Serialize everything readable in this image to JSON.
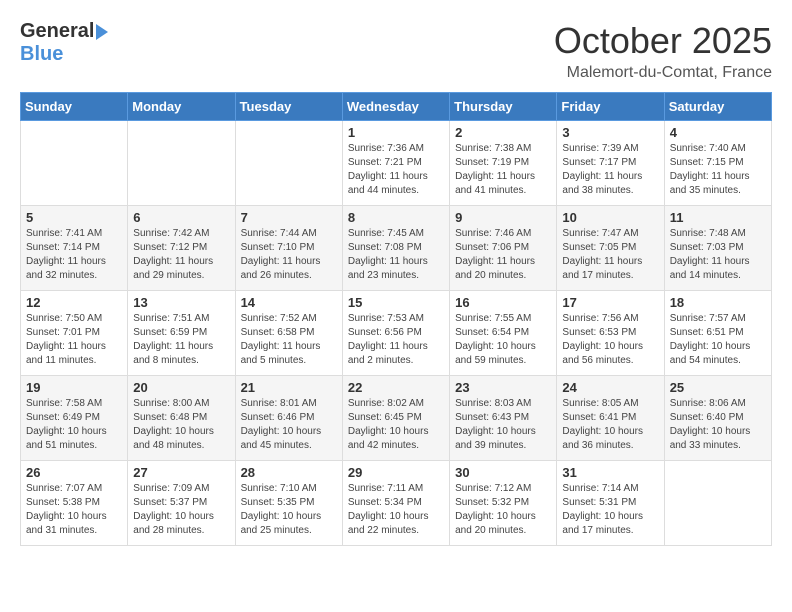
{
  "header": {
    "logo_general": "General",
    "logo_blue": "Blue",
    "month": "October 2025",
    "location": "Malemort-du-Comtat, France"
  },
  "calendar": {
    "days_of_week": [
      "Sunday",
      "Monday",
      "Tuesday",
      "Wednesday",
      "Thursday",
      "Friday",
      "Saturday"
    ],
    "weeks": [
      [
        {
          "day": "",
          "info": ""
        },
        {
          "day": "",
          "info": ""
        },
        {
          "day": "",
          "info": ""
        },
        {
          "day": "1",
          "info": "Sunrise: 7:36 AM\nSunset: 7:21 PM\nDaylight: 11 hours and 44 minutes."
        },
        {
          "day": "2",
          "info": "Sunrise: 7:38 AM\nSunset: 7:19 PM\nDaylight: 11 hours and 41 minutes."
        },
        {
          "day": "3",
          "info": "Sunrise: 7:39 AM\nSunset: 7:17 PM\nDaylight: 11 hours and 38 minutes."
        },
        {
          "day": "4",
          "info": "Sunrise: 7:40 AM\nSunset: 7:15 PM\nDaylight: 11 hours and 35 minutes."
        }
      ],
      [
        {
          "day": "5",
          "info": "Sunrise: 7:41 AM\nSunset: 7:14 PM\nDaylight: 11 hours and 32 minutes."
        },
        {
          "day": "6",
          "info": "Sunrise: 7:42 AM\nSunset: 7:12 PM\nDaylight: 11 hours and 29 minutes."
        },
        {
          "day": "7",
          "info": "Sunrise: 7:44 AM\nSunset: 7:10 PM\nDaylight: 11 hours and 26 minutes."
        },
        {
          "day": "8",
          "info": "Sunrise: 7:45 AM\nSunset: 7:08 PM\nDaylight: 11 hours and 23 minutes."
        },
        {
          "day": "9",
          "info": "Sunrise: 7:46 AM\nSunset: 7:06 PM\nDaylight: 11 hours and 20 minutes."
        },
        {
          "day": "10",
          "info": "Sunrise: 7:47 AM\nSunset: 7:05 PM\nDaylight: 11 hours and 17 minutes."
        },
        {
          "day": "11",
          "info": "Sunrise: 7:48 AM\nSunset: 7:03 PM\nDaylight: 11 hours and 14 minutes."
        }
      ],
      [
        {
          "day": "12",
          "info": "Sunrise: 7:50 AM\nSunset: 7:01 PM\nDaylight: 11 hours and 11 minutes."
        },
        {
          "day": "13",
          "info": "Sunrise: 7:51 AM\nSunset: 6:59 PM\nDaylight: 11 hours and 8 minutes."
        },
        {
          "day": "14",
          "info": "Sunrise: 7:52 AM\nSunset: 6:58 PM\nDaylight: 11 hours and 5 minutes."
        },
        {
          "day": "15",
          "info": "Sunrise: 7:53 AM\nSunset: 6:56 PM\nDaylight: 11 hours and 2 minutes."
        },
        {
          "day": "16",
          "info": "Sunrise: 7:55 AM\nSunset: 6:54 PM\nDaylight: 10 hours and 59 minutes."
        },
        {
          "day": "17",
          "info": "Sunrise: 7:56 AM\nSunset: 6:53 PM\nDaylight: 10 hours and 56 minutes."
        },
        {
          "day": "18",
          "info": "Sunrise: 7:57 AM\nSunset: 6:51 PM\nDaylight: 10 hours and 54 minutes."
        }
      ],
      [
        {
          "day": "19",
          "info": "Sunrise: 7:58 AM\nSunset: 6:49 PM\nDaylight: 10 hours and 51 minutes."
        },
        {
          "day": "20",
          "info": "Sunrise: 8:00 AM\nSunset: 6:48 PM\nDaylight: 10 hours and 48 minutes."
        },
        {
          "day": "21",
          "info": "Sunrise: 8:01 AM\nSunset: 6:46 PM\nDaylight: 10 hours and 45 minutes."
        },
        {
          "day": "22",
          "info": "Sunrise: 8:02 AM\nSunset: 6:45 PM\nDaylight: 10 hours and 42 minutes."
        },
        {
          "day": "23",
          "info": "Sunrise: 8:03 AM\nSunset: 6:43 PM\nDaylight: 10 hours and 39 minutes."
        },
        {
          "day": "24",
          "info": "Sunrise: 8:05 AM\nSunset: 6:41 PM\nDaylight: 10 hours and 36 minutes."
        },
        {
          "day": "25",
          "info": "Sunrise: 8:06 AM\nSunset: 6:40 PM\nDaylight: 10 hours and 33 minutes."
        }
      ],
      [
        {
          "day": "26",
          "info": "Sunrise: 7:07 AM\nSunset: 5:38 PM\nDaylight: 10 hours and 31 minutes."
        },
        {
          "day": "27",
          "info": "Sunrise: 7:09 AM\nSunset: 5:37 PM\nDaylight: 10 hours and 28 minutes."
        },
        {
          "day": "28",
          "info": "Sunrise: 7:10 AM\nSunset: 5:35 PM\nDaylight: 10 hours and 25 minutes."
        },
        {
          "day": "29",
          "info": "Sunrise: 7:11 AM\nSunset: 5:34 PM\nDaylight: 10 hours and 22 minutes."
        },
        {
          "day": "30",
          "info": "Sunrise: 7:12 AM\nSunset: 5:32 PM\nDaylight: 10 hours and 20 minutes."
        },
        {
          "day": "31",
          "info": "Sunrise: 7:14 AM\nSunset: 5:31 PM\nDaylight: 10 hours and 17 minutes."
        },
        {
          "day": "",
          "info": ""
        }
      ]
    ]
  }
}
